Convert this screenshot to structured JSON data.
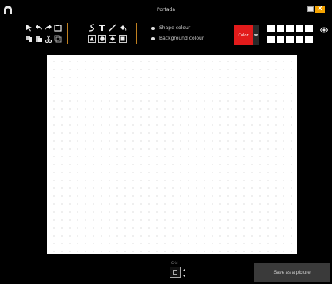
{
  "window": {
    "title": "Portada",
    "close_label": "X",
    "app_icon": "arch-logo-icon"
  },
  "toolbar": {
    "icons_row1": [
      "select-arrow-icon",
      "undo-icon",
      "redo-icon",
      "image-icon"
    ],
    "icons_row2": [
      "copy-icon",
      "paste-icon",
      "cut-icon",
      "duplicate-icon"
    ],
    "draw_row1": [
      "freehand-icon",
      "text-icon",
      "line-icon",
      "fill-icon"
    ],
    "draw_row2": [
      "triangle-shape-icon",
      "circle-shape-icon",
      "diamond-shape-icon",
      "square-shape-icon"
    ]
  },
  "colour_mode": {
    "options": [
      "Shape colour",
      "Background colour"
    ]
  },
  "color_picker": {
    "label": "Color",
    "selected_color": "#e21b1b"
  },
  "swatches": [
    "#ffffff",
    "#ffffff",
    "#ffffff",
    "#ffffff",
    "#ffffff",
    "#ffffff",
    "#ffffff",
    "#ffffff",
    "#ffffff",
    "#ffffff"
  ],
  "bottom": {
    "grid_label": "Grid",
    "save_label": "Save as a picture"
  }
}
